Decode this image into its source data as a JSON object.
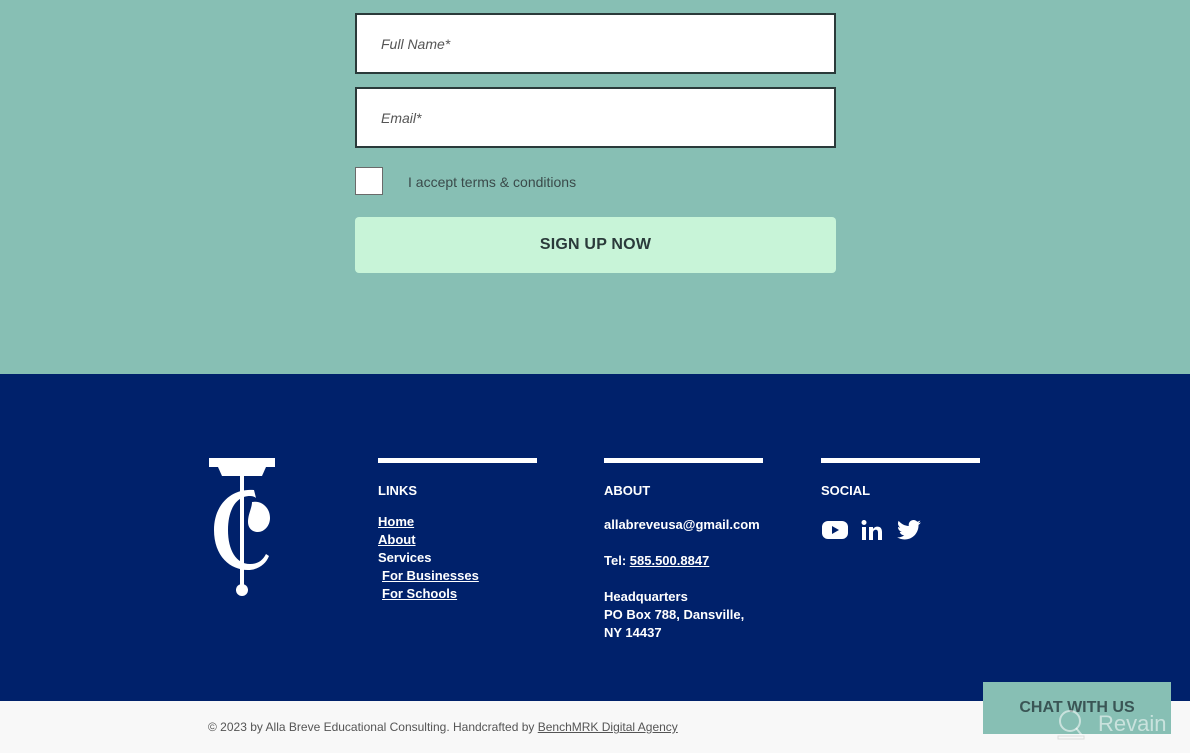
{
  "signup": {
    "full_name_placeholder": "Full Name*",
    "email_placeholder": "Email*",
    "terms_label": "I accept terms & conditions",
    "terms_checked": false,
    "submit_label": "SIGN UP NOW"
  },
  "footer": {
    "links": {
      "title": "LINKS",
      "items": [
        {
          "label": "Home"
        },
        {
          "label": "About"
        },
        {
          "label": "Services"
        },
        {
          "label": "For Businesses"
        },
        {
          "label": "For Schools"
        }
      ]
    },
    "about": {
      "title": "ABOUT",
      "email": "allabreveusa@gmail.com",
      "tel_prefix": "Tel: ",
      "tel": "585.500.8847",
      "hq_title": "Headquarters",
      "hq_line1": "PO Box 788, Dansville,",
      "hq_line2": "NY 14437"
    },
    "social": {
      "title": "SOCIAL",
      "icons": [
        "youtube-icon",
        "linkedin-icon",
        "twitter-icon"
      ]
    }
  },
  "bottom": {
    "copyright_text": "© 2023 by Alla Breve Educational Consulting. Handcrafted by ",
    "agency_link": "BenchMRK Digital Agency"
  },
  "chat": {
    "label": "CHAT WITH US"
  },
  "watermark": {
    "text": "Revain"
  },
  "colors": {
    "signup_bg": "#87bfb4",
    "button_bg": "#c8f4d8",
    "footer_bg": "#00216b",
    "bottom_bg": "#f8f8f8"
  }
}
